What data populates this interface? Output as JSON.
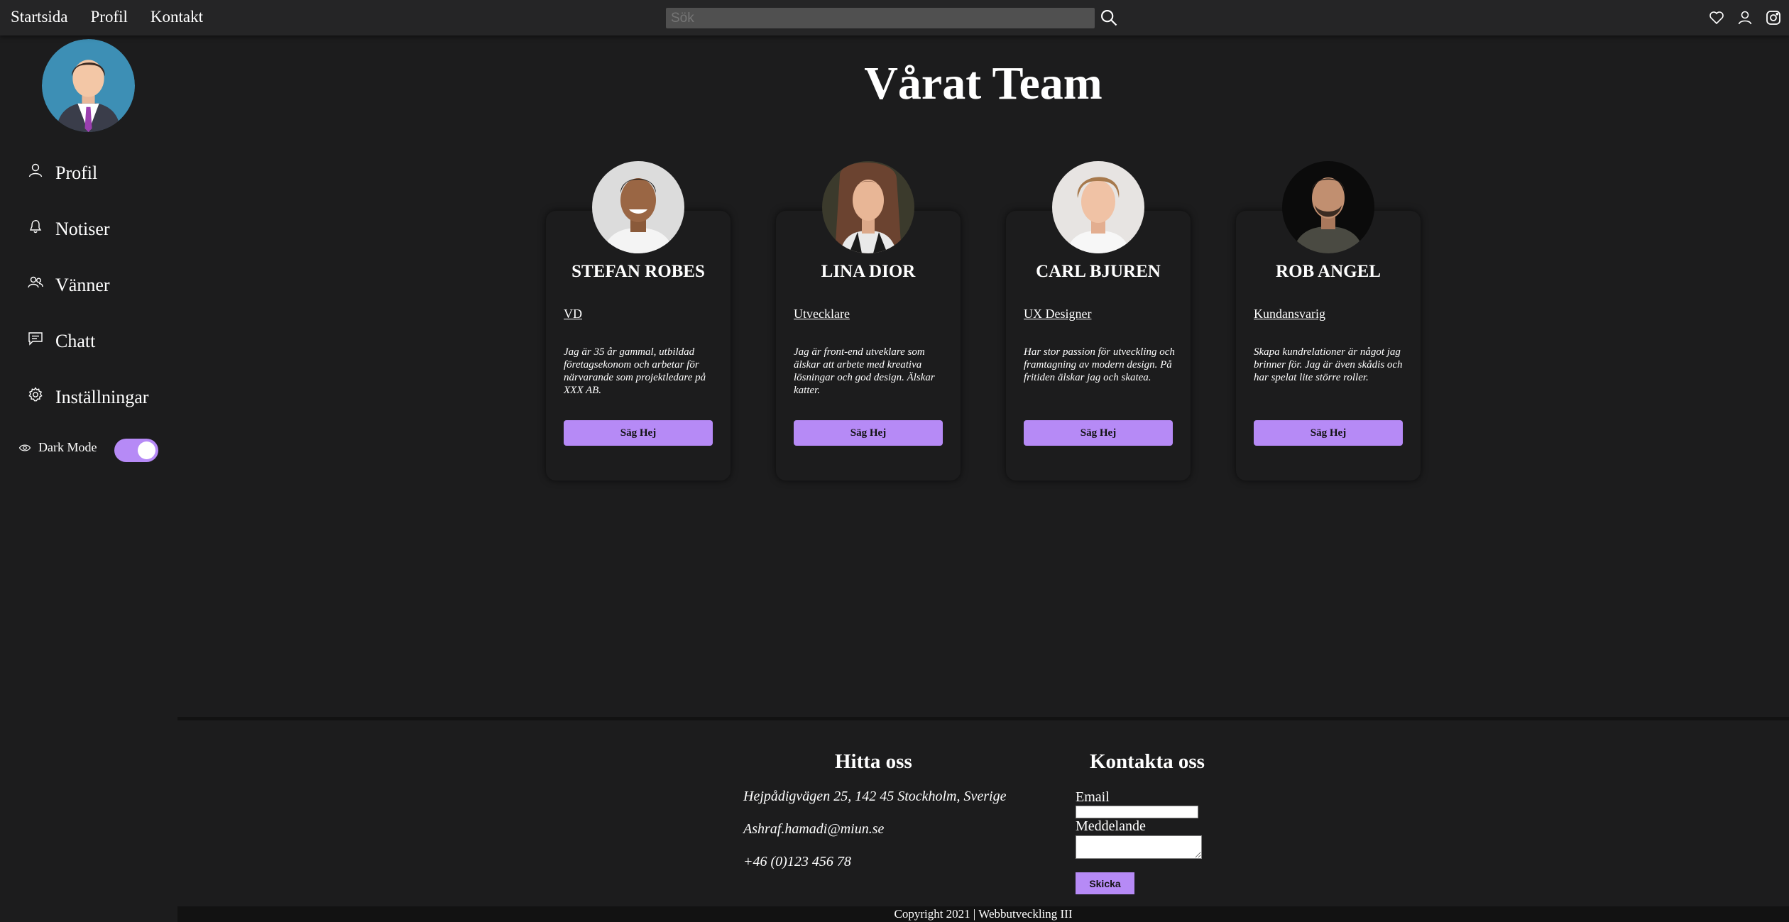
{
  "nav": {
    "links": [
      "Startsida",
      "Profil",
      "Kontakt"
    ],
    "search_placeholder": "Sök"
  },
  "sidebar": {
    "items": [
      {
        "label": "Profil",
        "icon": "user-icon"
      },
      {
        "label": "Notiser",
        "icon": "bell-icon"
      },
      {
        "label": "Vänner",
        "icon": "friends-icon"
      },
      {
        "label": "Chatt",
        "icon": "chat-icon"
      },
      {
        "label": "Inställningar",
        "icon": "gear-icon"
      }
    ],
    "dark_mode_label": "Dark Mode",
    "dark_mode_on": true
  },
  "main": {
    "title": "Vårat Team",
    "cards": [
      {
        "name": "STEFAN ROBES",
        "role": "VD",
        "description": "Jag är 35 år gammal, utbildad företagsekonom och arbetar för närvarande som projektledare på XXX AB.",
        "button": "Säg Hej"
      },
      {
        "name": "LINA DIOR",
        "role": "Utvecklare",
        "description": "Jag är front-end utveklare som älskar att arbete med kreativa lösningar och god design. Älskar katter.",
        "button": "Säg Hej"
      },
      {
        "name": "CARL BJUREN",
        "role": "UX Designer",
        "description": "Har stor passion för utveckling och framtagning av modern design. På fritiden älskar jag och skatea.",
        "button": "Säg Hej"
      },
      {
        "name": "ROB ANGEL",
        "role": "Kundansvarig",
        "description": "Skapa kundrelationer är något jag brinner för. Jag är även skådis och har spelat lite större roller.",
        "button": "Säg Hej"
      }
    ]
  },
  "footer": {
    "find_title": "Hitta oss",
    "address": "Hejpådigvägen 25, 142 45 Stockholm, Sverige",
    "email": "Ashraf.hamadi@miun.se",
    "phone": "+46 (0)123 456 78",
    "contact_title": "Kontakta oss",
    "email_label": "Email",
    "message_label": "Meddelande",
    "send_button": "Skicka",
    "copyright": "Copyright 2021 | Webbutveckling III"
  },
  "colors": {
    "accent": "#b68af6",
    "background": "#1c1c1d",
    "topbar": "#252526"
  }
}
